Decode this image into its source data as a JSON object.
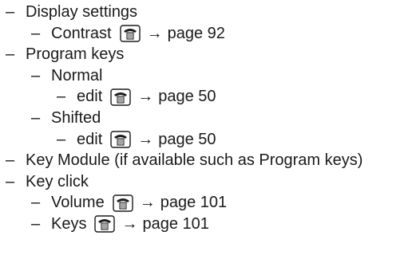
{
  "menu": {
    "display_settings": "Display settings",
    "contrast": "Contrast",
    "contrast_page": "page 92",
    "program_keys": "Program keys",
    "normal": "Normal",
    "normal_edit": "edit",
    "normal_edit_page": "page 50",
    "shifted": "Shifted",
    "shifted_edit": "edit",
    "shifted_edit_page": "page 50",
    "key_module": "Key Module (if available such as Program keys)",
    "key_click": "Key click",
    "volume": "Volume",
    "volume_page": "page 101",
    "keys": "Keys",
    "keys_page": "page 101"
  },
  "glyphs": {
    "dash": "–",
    "arrow": "→"
  },
  "icons": {
    "phone": "telephone-icon"
  }
}
